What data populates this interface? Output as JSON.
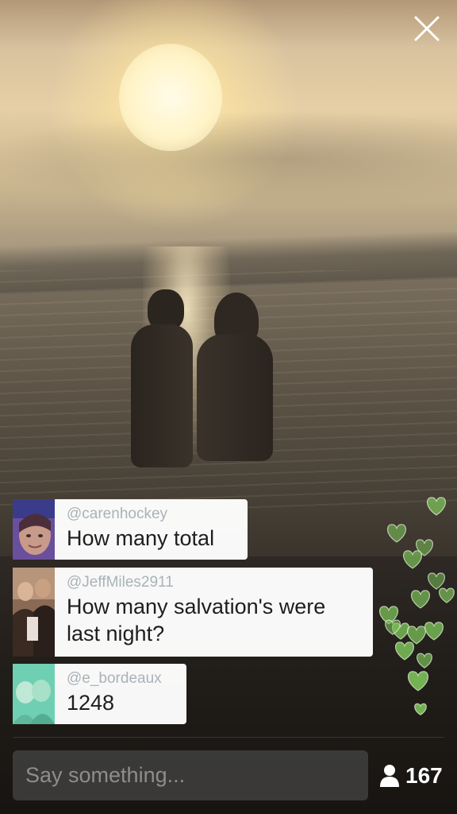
{
  "comments": [
    {
      "handle": "@carenhockey",
      "message": "How many total"
    },
    {
      "handle": "@JeffMiles2911",
      "message": "How many salvation's were last night?"
    },
    {
      "handle": "@e_bordeaux",
      "message": "1248"
    }
  ],
  "composer": {
    "placeholder": "Say something..."
  },
  "viewers": {
    "count": "167",
    "icon": "person-icon"
  },
  "icons": {
    "close": "close-icon",
    "hearts": "heart-icon"
  },
  "colors": {
    "heart_green": "#7cc25a",
    "bubble": "#ffffff",
    "handle_text": "#a9b3b8"
  }
}
